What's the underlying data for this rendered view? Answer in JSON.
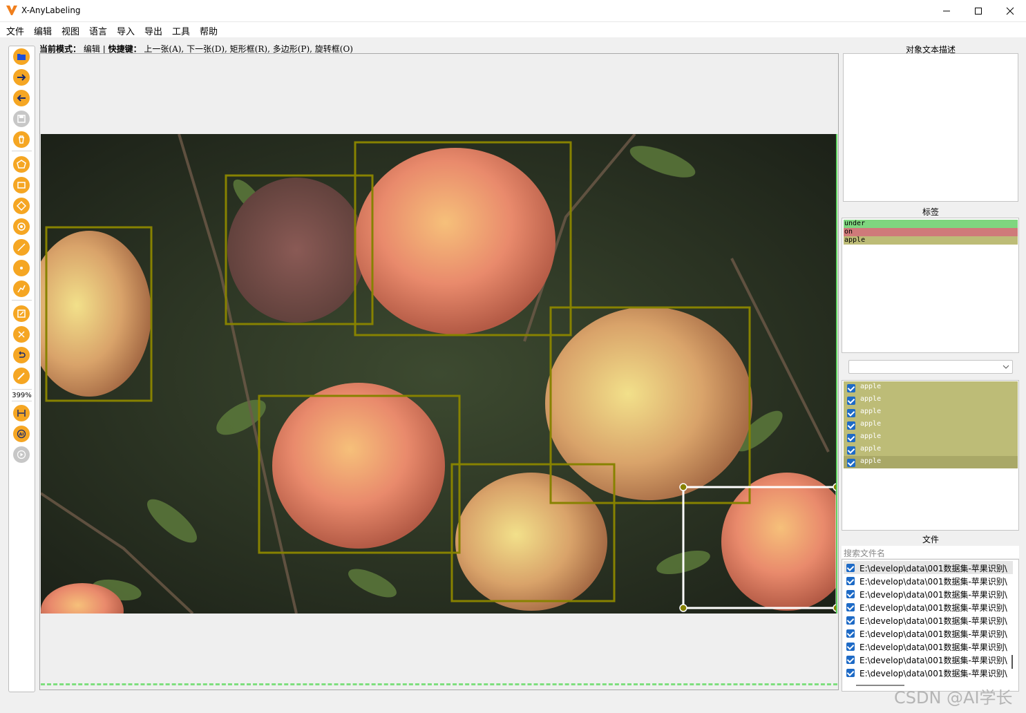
{
  "window": {
    "title": "X-AnyLabeling",
    "accent": "#f5a623"
  },
  "menu": [
    "文件",
    "编辑",
    "视图",
    "语言",
    "导入",
    "导出",
    "工具",
    "帮助"
  ],
  "mode_bar": {
    "mode_label": "当前模式：",
    "mode_value": "编辑",
    "separator": "|",
    "shortcut_label": "快捷键：",
    "shortcuts": "上一张(A), 下一张(D), 矩形框(R), 多边形(P), 旋转框(O)"
  },
  "toolbar": {
    "zoom": "399%",
    "icons": [
      "open-folder-icon",
      "next-image-icon",
      "prev-image-icon",
      "save-icon",
      "delete-file-icon",
      "polygon-icon",
      "rectangle-icon",
      "rotation-icon",
      "circle-icon",
      "line-icon",
      "point-icon",
      "linestrip-icon",
      "edit-icon",
      "delete-shape-icon",
      "undo-icon",
      "brush-icon",
      "fit-width-icon",
      "ai-icon",
      "play-icon"
    ]
  },
  "right_panel": {
    "description_title": "对象文本描述",
    "labels_title": "标签",
    "labels": [
      {
        "text": "under",
        "color": "#7fd67f"
      },
      {
        "text": "on",
        "color": "#cf7a7a"
      },
      {
        "text": "apple",
        "color": "#bdbc77"
      }
    ],
    "shapes": [
      "apple",
      "apple",
      "apple",
      "apple",
      "apple",
      "apple",
      "apple"
    ],
    "files_title": "文件",
    "search_placeholder": "搜索文件名",
    "files": [
      "E:\\develop\\data\\001数据集-苹果识别\\",
      "E:\\develop\\data\\001数据集-苹果识别\\",
      "E:\\develop\\data\\001数据集-苹果识别\\",
      "E:\\develop\\data\\001数据集-苹果识别\\",
      "E:\\develop\\data\\001数据集-苹果识别\\",
      "E:\\develop\\data\\001数据集-苹果识别\\",
      "E:\\develop\\data\\001数据集-苹果识别\\",
      "E:\\develop\\data\\001数据集-苹果识别\\",
      "E:\\develop\\data\\001数据集-苹果识别\\"
    ]
  },
  "watermark": "CSDN @AI学长"
}
